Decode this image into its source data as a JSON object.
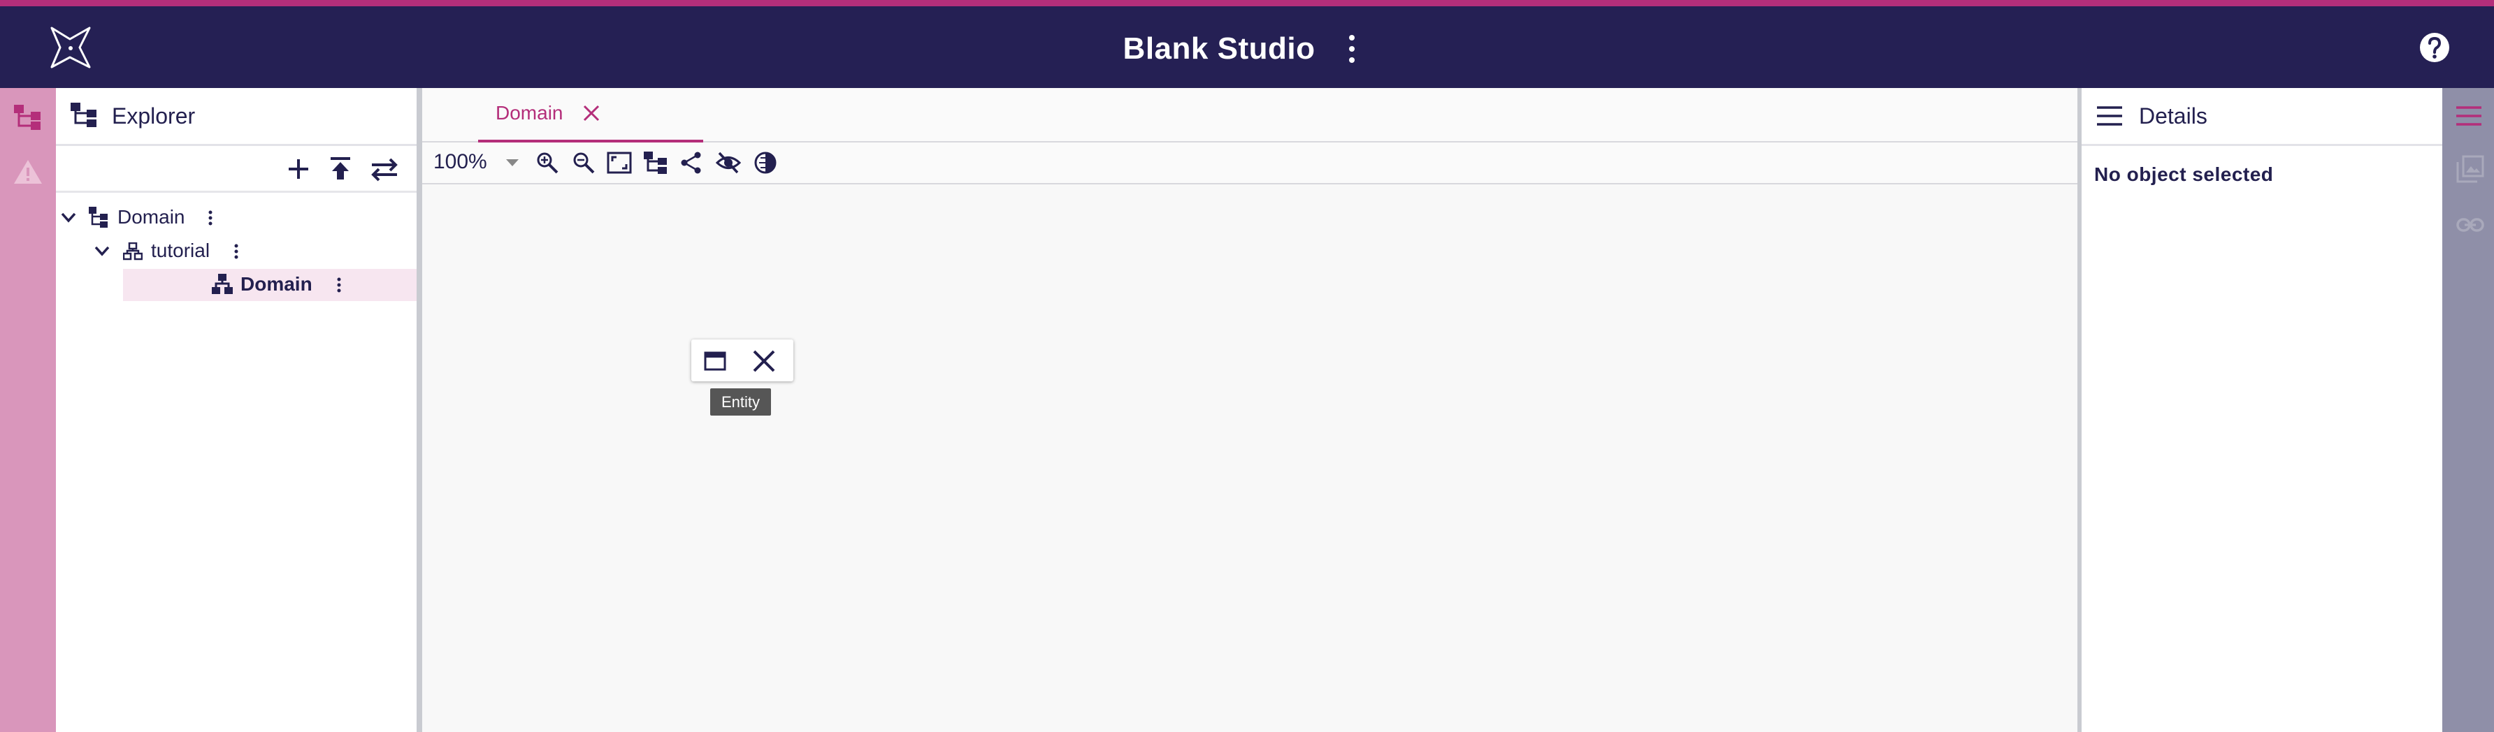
{
  "header": {
    "app_title": "Blank Studio",
    "brand_color": "#252054",
    "accent_color": "#b42e7a"
  },
  "left_sidebar": {
    "icons": [
      "explorer-tree-icon",
      "warning-icon"
    ]
  },
  "explorer": {
    "title": "Explorer",
    "toolbar": [
      "add-icon",
      "upload-icon",
      "swap-icon"
    ],
    "tree": [
      {
        "label": "Domain",
        "expanded": true
      },
      {
        "label": "tutorial",
        "expanded": true
      },
      {
        "label": "Domain",
        "selected": true
      }
    ]
  },
  "editor": {
    "tab_label": "Domain",
    "zoom": "100%",
    "tooltip": "Entity",
    "toolbar_icons": [
      "zoom-in-icon",
      "zoom-out-icon",
      "fit-screen-icon",
      "tree-layout-icon",
      "share-icon",
      "visibility-off-icon",
      "contrast-icon"
    ]
  },
  "details": {
    "title": "Details",
    "empty_message": "No object selected"
  },
  "right_sidebar": {
    "icons": [
      "menu-icon",
      "image-icon",
      "link-icon"
    ]
  }
}
